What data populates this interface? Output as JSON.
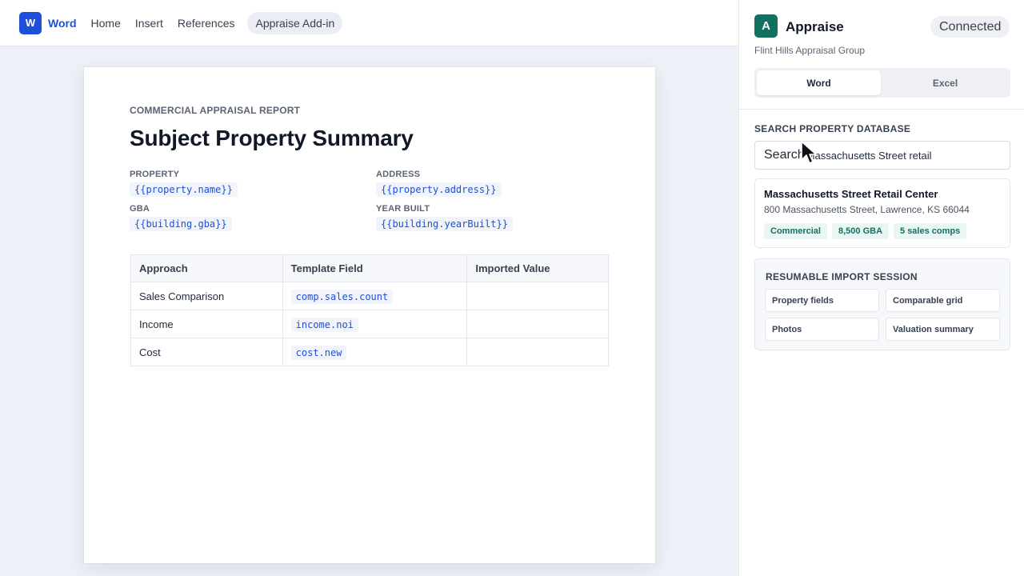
{
  "ribbon": {
    "logo_letter": "W",
    "app_name": "Word",
    "menu": [
      "Home",
      "Insert",
      "References",
      "Appraise Add-in"
    ]
  },
  "document": {
    "kicker": "COMMERCIAL APPRAISAL REPORT",
    "title": "Subject Property Summary",
    "fields": [
      {
        "label": "PROPERTY",
        "token": "{{property.name}}"
      },
      {
        "label": "ADDRESS",
        "token": "{{property.address}}"
      },
      {
        "label": "GBA",
        "token": "{{building.gba}}"
      },
      {
        "label": "YEAR BUILT",
        "token": "{{building.yearBuilt}}"
      }
    ],
    "table": {
      "headers": [
        "Approach",
        "Template Field",
        "Imported Value"
      ],
      "rows": [
        {
          "approach": "Sales Comparison",
          "field": "comp.sales.count",
          "value": ""
        },
        {
          "approach": "Income",
          "field": "income.noi",
          "value": ""
        },
        {
          "approach": "Cost",
          "field": "cost.new",
          "value": ""
        }
      ]
    }
  },
  "pane": {
    "logo_letter": "A",
    "title": "Appraise",
    "status": "Connected",
    "org": "Flint Hills Appraisal Group",
    "tabs": [
      "Word",
      "Excel"
    ],
    "search_section": "SEARCH PROPERTY DATABASE",
    "search_placeholder": "Search",
    "search_value": "Massachusetts Street retail",
    "result": {
      "title": "Massachusetts Street Retail Center",
      "address": "800 Massachusetts Street, Lawrence, KS 66044",
      "chips": [
        "Commercial",
        "8,500 GBA",
        "5 sales comps"
      ]
    },
    "session": {
      "title": "RESUMABLE IMPORT SESSION",
      "items": [
        "Property fields",
        "Comparable grid",
        "Photos",
        "Valuation summary"
      ]
    }
  },
  "colors": {
    "word_blue": "#1d4fd8",
    "appraise_green": "#127060",
    "chip_bg": "#eaf6f3"
  },
  "icons": {
    "word_logo": "word-logo-icon",
    "appraise_logo": "appraise-logo-icon",
    "cursor": "mouse-pointer-icon"
  }
}
